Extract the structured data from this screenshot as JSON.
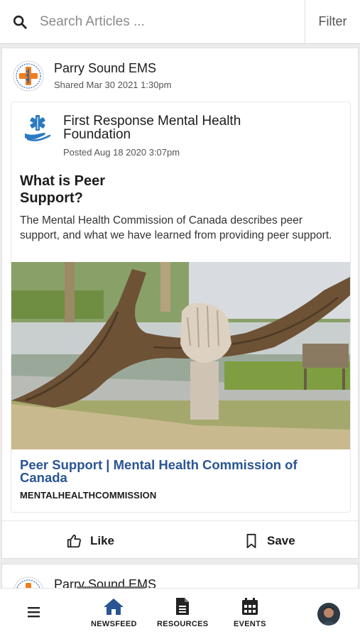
{
  "search": {
    "placeholder": "Search Articles ...",
    "filter_label": "Filter"
  },
  "post": {
    "shared_by": "Parry Sound EMS",
    "shared_meta": "Shared Mar 30 2021 1:30pm",
    "article": {
      "org": "First Response Mental Health Foundation",
      "posted_meta": "Posted Aug 18 2020 3:07pm",
      "title": "What is Peer Support?",
      "description": "The Mental Health Commission of Canada describes peer support, and what we have learned from providing peer support.",
      "link_title": "Peer Support | Mental Health Commission of Canada",
      "link_source": "MENTALHEALTHCOMMISSION"
    },
    "actions": {
      "like": "Like",
      "save": "Save"
    }
  },
  "next_post": {
    "shared_by": "Parry Sound EMS"
  },
  "nav": {
    "items": [
      {
        "label": "NEWSFEED",
        "icon": "home-icon"
      },
      {
        "label": "RESOURCES",
        "icon": "document-icon"
      },
      {
        "label": "EVENTS",
        "icon": "calendar-icon"
      }
    ]
  },
  "colors": {
    "link": "#2a5593",
    "nav_active": "#2a5593",
    "text": "#1c1c1c"
  }
}
